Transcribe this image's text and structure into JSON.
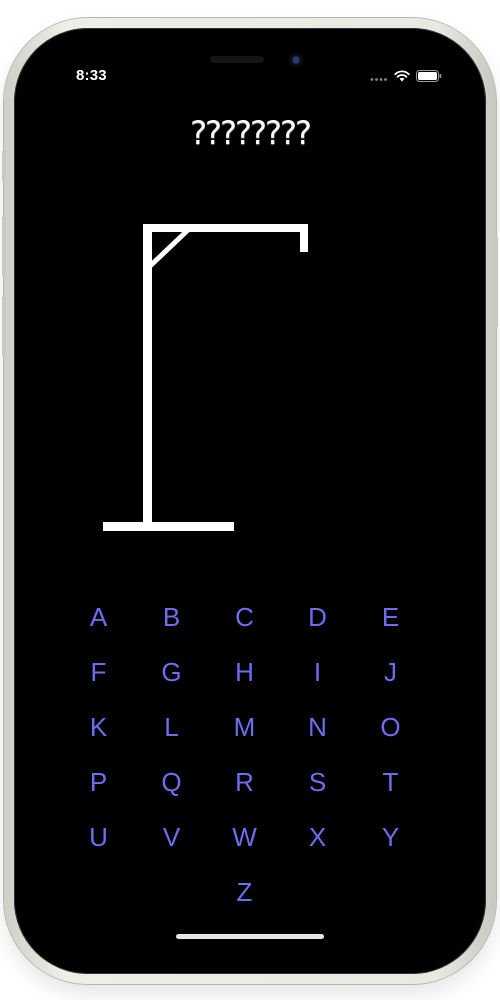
{
  "status_bar": {
    "time": "8:33",
    "icons": [
      "signal-icon",
      "wifi-icon",
      "battery-icon"
    ]
  },
  "game": {
    "masked_word": "????????",
    "wrong_guesses": 0
  },
  "keyboard": {
    "letters": [
      "A",
      "B",
      "C",
      "D",
      "E",
      "F",
      "G",
      "H",
      "I",
      "J",
      "K",
      "L",
      "M",
      "N",
      "O",
      "P",
      "Q",
      "R",
      "S",
      "T",
      "U",
      "V",
      "W",
      "X",
      "Y",
      "Z"
    ]
  },
  "colors": {
    "background": "#000000",
    "letter": "#6d6df2",
    "gallows": "#ffffff"
  }
}
